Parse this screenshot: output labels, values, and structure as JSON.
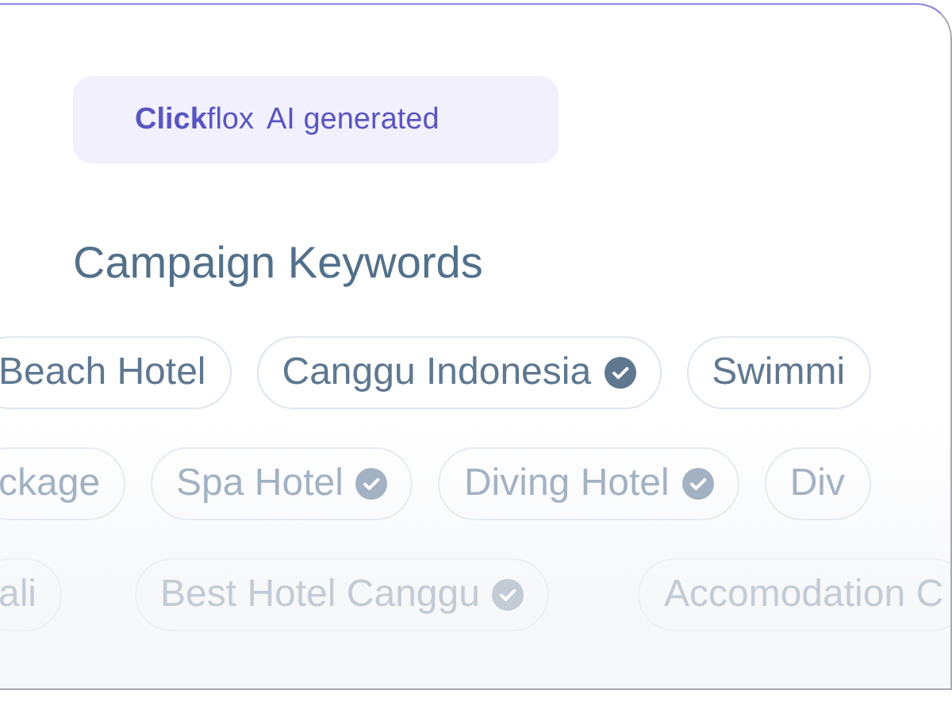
{
  "badge": {
    "brand": "**Click**flox",
    "label": "AI generated"
  },
  "title": "Campaign Keywords",
  "keyword_rows": [
    {
      "chips": [
        {
          "label": "Beach Hotel",
          "verified": false
        },
        {
          "label": "Canggu Indonesia",
          "verified": true
        },
        {
          "label": "Swimmi",
          "verified": false
        }
      ]
    },
    {
      "chips": [
        {
          "label": "ckage",
          "verified": false
        },
        {
          "label": "Spa Hotel",
          "verified": true
        },
        {
          "label": "Diving Hotel",
          "verified": true
        },
        {
          "label": "Div",
          "verified": false
        }
      ]
    },
    {
      "chips": [
        {
          "label": "ali",
          "verified": false
        },
        {
          "label": "Best Hotel Canggu",
          "verified": true
        },
        {
          "label": "Accomodation C",
          "verified": false
        }
      ]
    }
  ]
}
